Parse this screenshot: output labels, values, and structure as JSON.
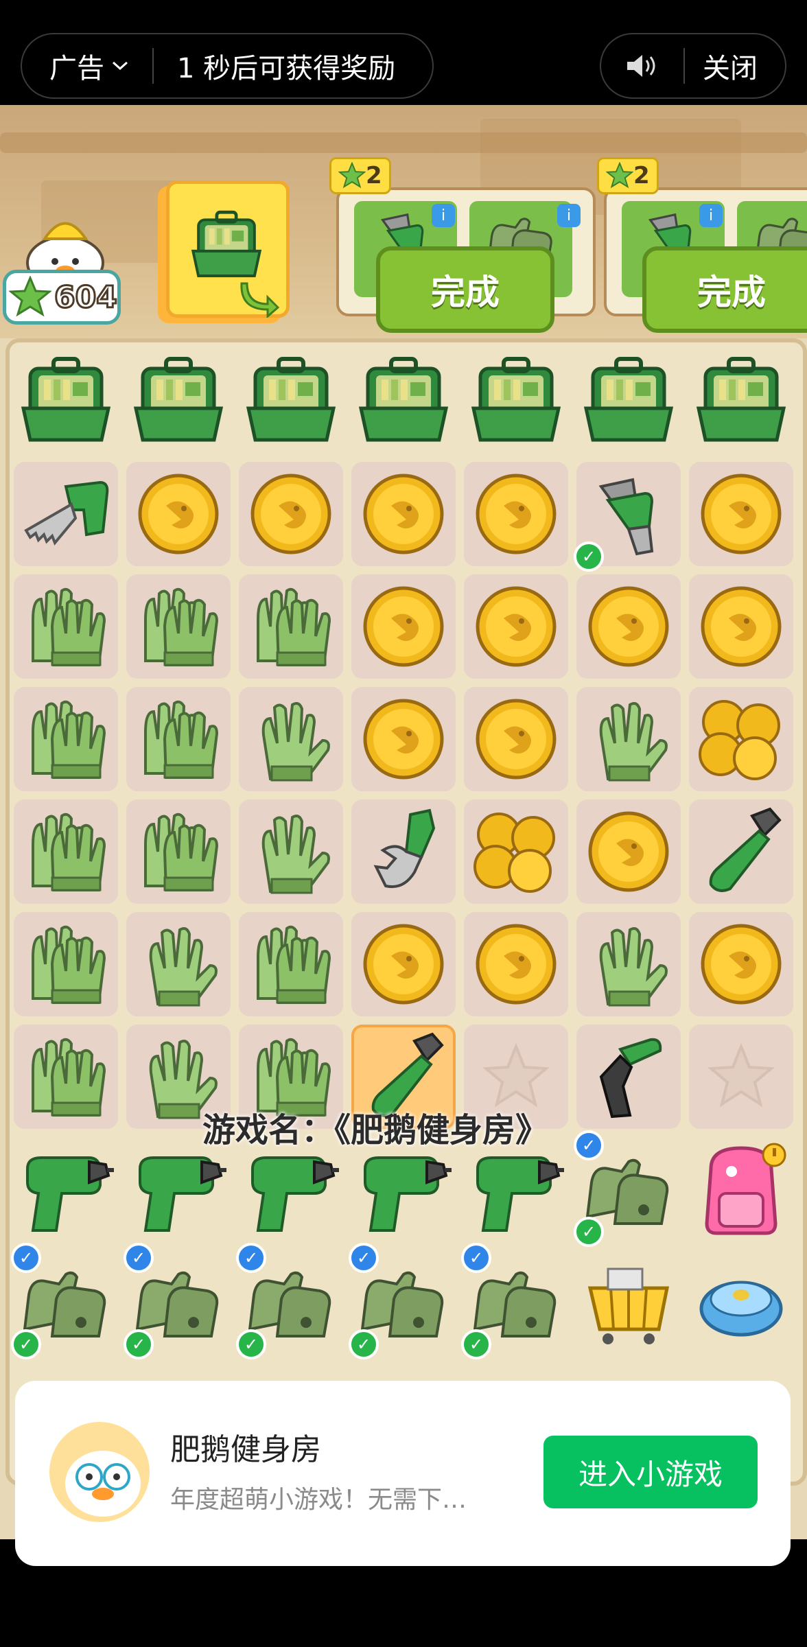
{
  "ad_bar": {
    "ad_label": "广告",
    "countdown": "1 秒后可获得奖励",
    "close_label": "关闭"
  },
  "hud": {
    "star_count": "604",
    "order1_reward": "2",
    "order2_reward": "2",
    "done_label": "完成"
  },
  "overlay_text": "游戏名：《肥鹅健身房》",
  "board": {
    "rows": [
      [
        "toolbox",
        "toolbox",
        "toolbox",
        "toolbox",
        "toolbox",
        "toolbox",
        "toolbox"
      ],
      [
        "saw",
        "coin",
        "coin",
        "coin",
        "coin",
        "pliers",
        "coin"
      ],
      [
        "gloves",
        "gloves",
        "gloves",
        "coin",
        "coin",
        "coin",
        "coin"
      ],
      [
        "gloves",
        "gloves",
        "glove",
        "coin",
        "coin",
        "glove",
        "coins"
      ],
      [
        "gloves",
        "gloves",
        "glove",
        "wrench",
        "coins",
        "coin",
        "screwdriver"
      ],
      [
        "gloves",
        "glove",
        "gloves",
        "coin",
        "coin",
        "glove",
        "coin"
      ],
      [
        "gloves",
        "glove",
        "gloves",
        "screwdriver",
        "star",
        "hexkey",
        "star"
      ],
      [
        "drill",
        "drill",
        "drill",
        "drill",
        "drill",
        "workgloves",
        "backpack"
      ],
      [
        "workgloves",
        "workgloves",
        "workgloves",
        "workgloves",
        "workgloves",
        "basket",
        "robot-vacuum"
      ]
    ]
  },
  "mini_program": {
    "name": "肥鹅健身房",
    "description": "年度超萌小游戏！无需下…",
    "cta": "进入小游戏"
  },
  "colors": {
    "accent_green": "#07c160",
    "done_green": "#86c233"
  }
}
